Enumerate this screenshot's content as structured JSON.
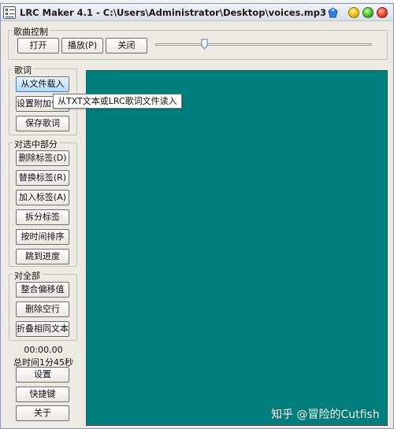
{
  "window": {
    "title": "LRC Maker 4.1 - C:\\Users\\Administrator\\Desktop\\voices.mp3"
  },
  "song_control": {
    "label": "歌曲控制",
    "open_label": "打开",
    "play_label": "播放(P)",
    "close_label": "关闭"
  },
  "lyrics": {
    "label": "歌词",
    "load_label": "从文件载入",
    "attach_label": "设置附加信息",
    "save_label": "保存歌词",
    "tooltip": "从TXT文本或LRC歌词文件读入"
  },
  "selected": {
    "label": "对选中部分",
    "delete_tag_label": "删除标签(D)",
    "replace_tag_label": "替换标签(R)",
    "add_tag_label": "加入标签(A)",
    "split_tag_label": "拆分标签",
    "sort_time_label": "按时间排序",
    "jump_label": "跳到进度"
  },
  "all": {
    "label": "对全部",
    "merge_label": "整合偏移值",
    "del_blank_label": "删除空行",
    "fold_label": "折叠相同文本"
  },
  "status": {
    "time": "00:00.00",
    "total": "总时间1分45秒"
  },
  "bottom": {
    "settings_label": "设置",
    "shortcuts_label": "快捷键",
    "about_label": "关于"
  },
  "watermark": "知乎 @冒险的Cutfish",
  "colors": {
    "lyric_area": "#007e7e"
  }
}
